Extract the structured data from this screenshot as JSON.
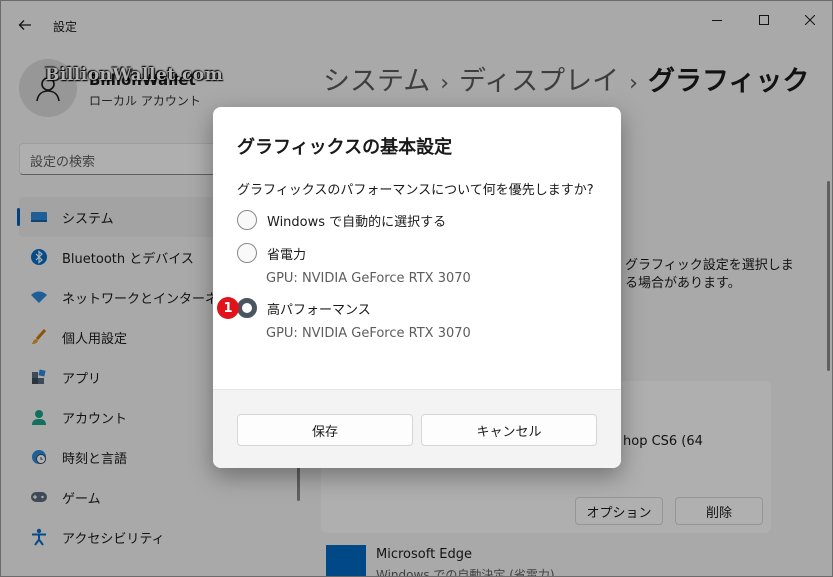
{
  "window": {
    "title": "設定"
  },
  "profile": {
    "name": "BillionWallet",
    "account_type": "ローカル アカウント"
  },
  "watermark": "BillionWallet.com",
  "search": {
    "placeholder": "設定の検索"
  },
  "nav": {
    "items": [
      {
        "label": "システム",
        "icon": "monitor-icon",
        "selected": true
      },
      {
        "label": "Bluetooth とデバイス",
        "icon": "bluetooth-icon"
      },
      {
        "label": "ネットワークとインターネット",
        "icon": "wifi-icon"
      },
      {
        "label": "個人用設定",
        "icon": "brush-icon"
      },
      {
        "label": "アプリ",
        "icon": "apps-icon"
      },
      {
        "label": "アカウント",
        "icon": "person-icon"
      },
      {
        "label": "時刻と言語",
        "icon": "globe-clock-icon"
      },
      {
        "label": "ゲーム",
        "icon": "gamepad-icon"
      },
      {
        "label": "アクセシビリティ",
        "icon": "accessibility-icon"
      }
    ]
  },
  "breadcrumb": {
    "level1": "システム",
    "level2": "ディスプレイ",
    "current": "グラフィック",
    "separator": "›"
  },
  "background": {
    "text_line1": "グラフィック設定を選択しま",
    "text_line2": "る場合があります。",
    "app_text": "hop CS6 (64",
    "options_label": "オプション",
    "remove_label": "削除",
    "edge_name": "Microsoft Edge",
    "edge_sub": "Windows での自動決定 (省電力)"
  },
  "dialog": {
    "title": "グラフィックスの基本設定",
    "question": "グラフィックスのパフォーマンスについて何を優先しますか?",
    "options": [
      {
        "label": "Windows で自動的に選択する",
        "checked": false
      },
      {
        "label": "省電力",
        "gpu": "GPU: NVIDIA GeForce RTX 3070",
        "checked": false
      },
      {
        "label": "高パフォーマンス",
        "gpu": "GPU: NVIDIA GeForce RTX 3070",
        "checked": true
      }
    ],
    "badge": "1",
    "save_label": "保存",
    "cancel_label": "キャンセル"
  },
  "colors": {
    "accent": "#005fb8",
    "badge": "#e0121a"
  }
}
